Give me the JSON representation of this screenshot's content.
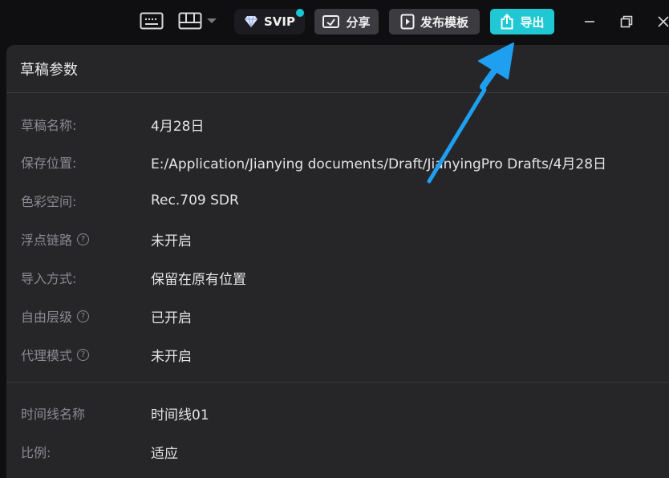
{
  "toolbar": {
    "svip_label": "SVIP",
    "share_label": "分享",
    "publish_label": "发布模板",
    "export_label": "导出"
  },
  "colors": {
    "accent": "#1fc8d2",
    "arrow": "#1e9ff0",
    "panel_bg": "#262629",
    "app_bg": "#0f0f11"
  },
  "panel": {
    "title": "草稿参数",
    "rows": [
      {
        "label": "草稿名称:",
        "value": "4月28日"
      },
      {
        "label": "保存位置:",
        "value": "E:/Application/Jianying documents/Draft/JianyingPro Drafts/4月28日"
      },
      {
        "label": "色彩空间:",
        "value": "Rec.709 SDR"
      },
      {
        "label": "浮点链路",
        "value": "未开启",
        "help": "?"
      },
      {
        "label": "导入方式:",
        "value": "保留在原有位置"
      },
      {
        "label": "自由层级",
        "value": "已开启",
        "help": "?"
      },
      {
        "label": "代理模式",
        "value": "未开启",
        "help": "?"
      }
    ],
    "timeline_rows": [
      {
        "label": "时间线名称",
        "value": "时间线01"
      },
      {
        "label": "比例:",
        "value": "适应"
      }
    ]
  }
}
